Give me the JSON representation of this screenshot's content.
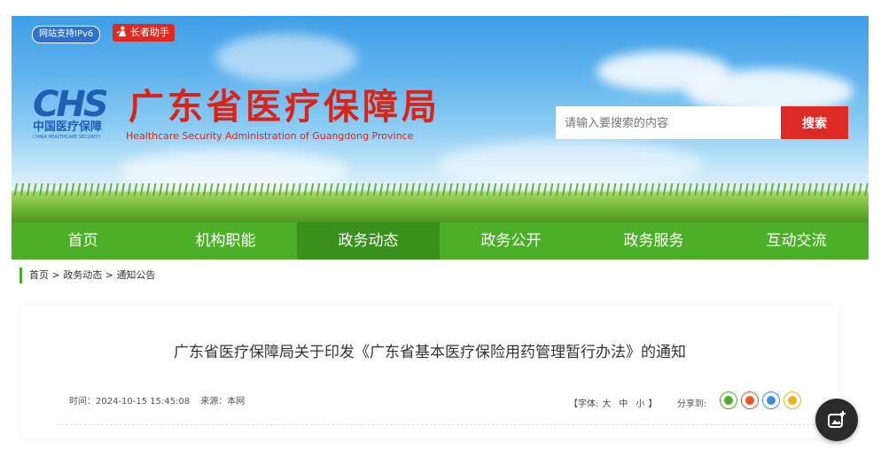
{
  "header": {
    "ipv6_badge": "网站支持IPv6",
    "elder_badge": "长者助手",
    "logo_chs": "CHS",
    "logo_cn": "中国医疗保障",
    "logo_en": "CHINA HEALTHCARE SECURITY",
    "title_cn": "广东省医疗保障局",
    "title_en": "Healthcare Security Administration of Guangdong Province"
  },
  "search": {
    "placeholder": "请输入要搜索的内容",
    "button_label": "搜索"
  },
  "nav": {
    "items": [
      {
        "label": "首页",
        "active": false
      },
      {
        "label": "机构职能",
        "active": false
      },
      {
        "label": "政务动态",
        "active": true
      },
      {
        "label": "政务公开",
        "active": false
      },
      {
        "label": "政务服务",
        "active": false
      },
      {
        "label": "互动交流",
        "active": false
      }
    ]
  },
  "breadcrumb": {
    "home": "首页",
    "sep1": " > ",
    "section": "政务动态",
    "sep2": " > ",
    "current": "通知公告"
  },
  "article": {
    "title": "广东省医疗保障局关于印发《广东省基本医疗保险用药管理暂行办法》的通知",
    "time": "时间：2024-10-15 15:45:08",
    "source": "来源：本网",
    "font_ctl_prefix": "【字体:",
    "font_large": "大",
    "font_medium": "中",
    "font_small": "小",
    "font_ctl_suffix": "】",
    "share_label": "分享到:"
  },
  "share_icons": [
    "wechat-icon",
    "weibo-icon",
    "qq-icon",
    "qzone-icon"
  ],
  "colors": {
    "nav_green": "#4caf28",
    "nav_active": "#3a901c",
    "title_red": "#d92418",
    "logo_blue": "#1f5fb4",
    "search_red": "#dc2a25"
  }
}
